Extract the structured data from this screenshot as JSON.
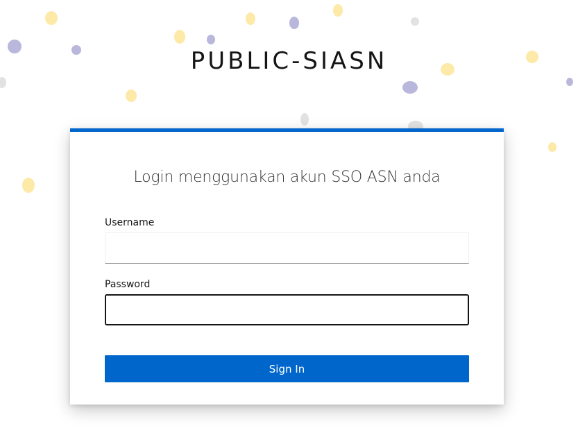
{
  "brand": {
    "title": "PUBLIC-SIASN"
  },
  "login_card": {
    "heading": "Login menggunakan akun SSO ASN anda",
    "username_label": "Username",
    "username_value": "",
    "password_label": "Password",
    "password_value": "",
    "sign_in_label": "Sign In"
  },
  "colors": {
    "accent": "#0066cc",
    "card_border_top": "#0066cc",
    "confetti_yellow": "#fde9a8",
    "confetti_purple": "#b9b8dc",
    "confetti_gray": "#e2e2e2"
  }
}
